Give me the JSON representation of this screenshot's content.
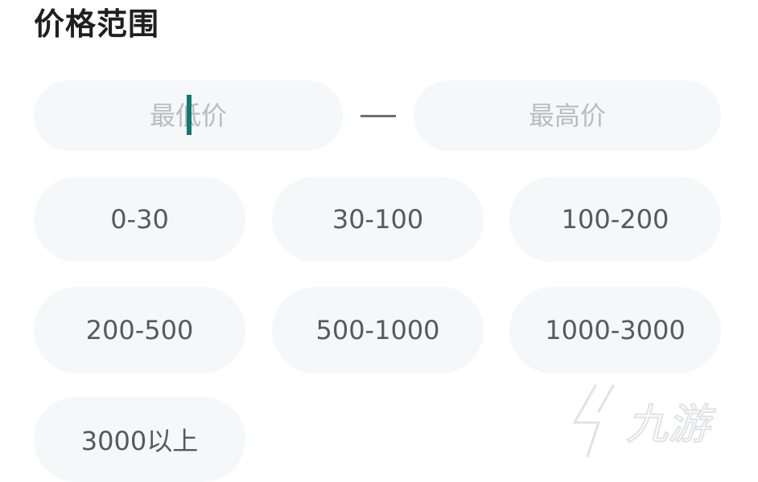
{
  "section": {
    "title": "价格范围"
  },
  "price_range": {
    "min_placeholder": "最低价",
    "max_placeholder": "最高价",
    "min_value": "",
    "max_value": ""
  },
  "options": [
    {
      "label": "0-30"
    },
    {
      "label": "30-100"
    },
    {
      "label": "100-200"
    },
    {
      "label": "200-500"
    },
    {
      "label": "500-1000"
    },
    {
      "label": "1000-3000"
    },
    {
      "label": "3000以上"
    }
  ],
  "watermark": {
    "text": "九游"
  },
  "colors": {
    "pill_background": "#f6f7f9",
    "caret": "#0f7a6c",
    "text": "#555a60",
    "placeholder": "#b9bcc1"
  }
}
